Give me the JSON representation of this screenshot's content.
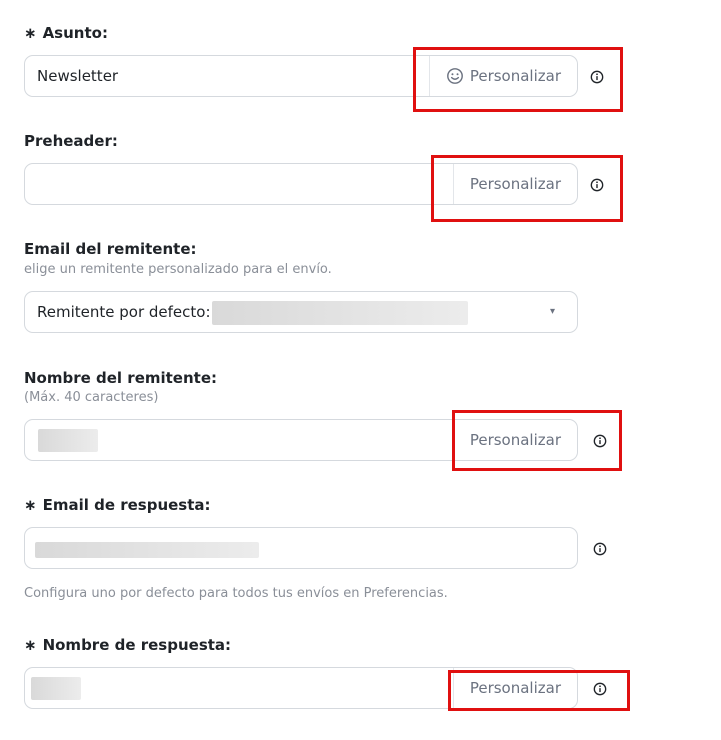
{
  "form": {
    "asunto": {
      "label": "Asunto:",
      "required_mark": "∗",
      "value": "Newsletter",
      "personalize": "Personalizar"
    },
    "preheader": {
      "label": "Preheader:",
      "value": "",
      "personalize": "Personalizar"
    },
    "email_remitente": {
      "label": "Email del remitente:",
      "hint": "elige un remitente personalizado para el envío.",
      "selected": "Remitente por defecto:",
      "arrow": "▾"
    },
    "nombre_remitente": {
      "label": "Nombre del remitente:",
      "hint": "(Máx. 40 caracteres)",
      "personalize": "Personalizar"
    },
    "email_respuesta": {
      "label": "Email de respuesta:",
      "required_mark": "∗",
      "hint": "Configura uno por defecto para todos tus envíos en Preferencias."
    },
    "nombre_respuesta": {
      "label": "Nombre de respuesta:",
      "required_mark": "∗",
      "personalize": "Personalizar"
    }
  },
  "icons": {
    "info": "info-circle-icon",
    "smile": "smile-icon",
    "dropdown": "chevron-down-icon"
  },
  "colors": {
    "highlight": "#e01010",
    "border": "#d5d9de",
    "muted": "#8a8f98"
  }
}
